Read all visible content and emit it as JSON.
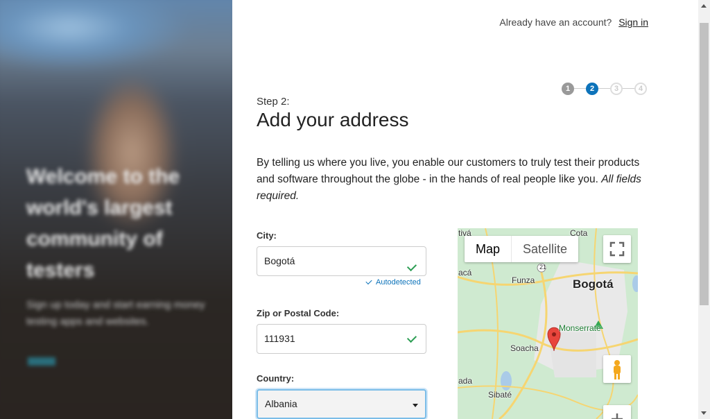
{
  "hero": {
    "heading": "Welcome to the world's largest community of testers",
    "body": "Sign up today and start earning money testing apps and websites.",
    "link": "Learn"
  },
  "header": {
    "account_prompt": "Already have an account?",
    "signin_label": "Sign in"
  },
  "stepper": {
    "steps": [
      "1",
      "2",
      "3",
      "4"
    ],
    "current": 2
  },
  "form": {
    "step_label": "Step 2:",
    "title": "Add your address",
    "intro": "By telling us where you live, you enable our customers to truly test their products and software throughout the globe - in the hands of real people like you.",
    "intro_em": "All fields required.",
    "city": {
      "label": "City:",
      "value": "Bogotá",
      "note": "Autodetected"
    },
    "zip": {
      "label": "Zip or Postal Code:",
      "value": "111931"
    },
    "country": {
      "label": "Country:",
      "value": "Albania"
    }
  },
  "map": {
    "type_buttons": [
      "Map",
      "Satellite"
    ],
    "places": {
      "city": "Bogotá",
      "funza": "Funza",
      "soacha": "Soacha",
      "monserrate": "Monserrate",
      "sibate": "Sibaté",
      "cota": "Cota",
      "tiva": "tivá",
      "aca": "acá",
      "ada": "ada",
      "road": "21"
    }
  },
  "colors": {
    "accent": "#0d73ba",
    "success": "#2e9e55",
    "done_step": "#999999"
  }
}
